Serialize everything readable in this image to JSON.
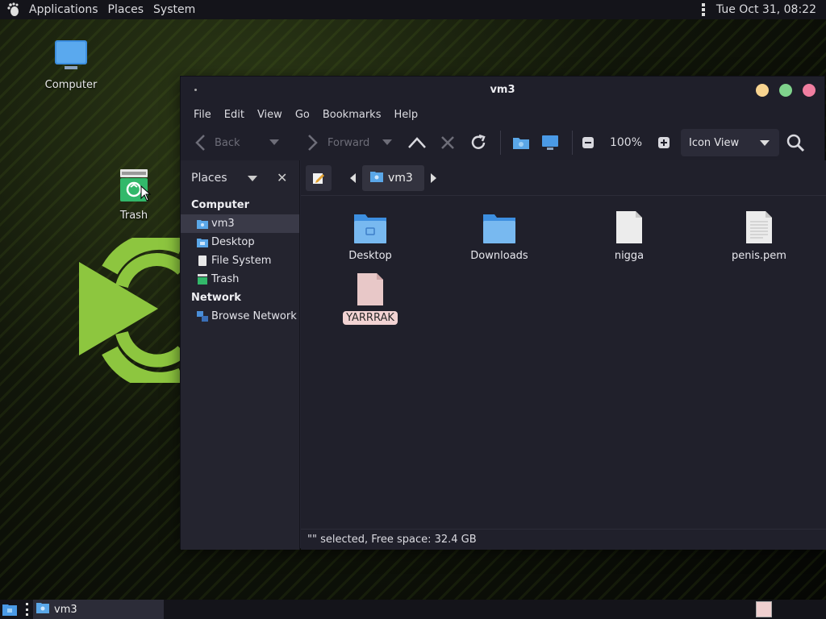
{
  "top_panel": {
    "menus": [
      "Applications",
      "Places",
      "System"
    ],
    "clock": "Tue Oct 31, 08:22"
  },
  "desktop": {
    "icons": [
      {
        "label": "Computer",
        "icon": "monitor-icon"
      },
      {
        "label": "Trash",
        "icon": "trash-icon"
      }
    ]
  },
  "window": {
    "title": "vm3",
    "menubar": [
      "File",
      "Edit",
      "View",
      "Go",
      "Bookmarks",
      "Help"
    ],
    "toolbar": {
      "back_label": "Back",
      "forward_label": "Forward",
      "zoom": "100%",
      "view_mode": "Icon View"
    },
    "sidebar": {
      "header": "Places",
      "sections": [
        {
          "title": "Computer",
          "items": [
            "vm3",
            "Desktop",
            "File System",
            "Trash"
          ]
        },
        {
          "title": "Network",
          "items": [
            "Browse Network"
          ]
        }
      ],
      "selected": "vm3"
    },
    "pathbar": {
      "crumb": "vm3"
    },
    "files": [
      {
        "name": "Desktop",
        "type": "folder"
      },
      {
        "name": "Downloads",
        "type": "folder"
      },
      {
        "name": "nigga",
        "type": "file"
      },
      {
        "name": "penis.pem",
        "type": "text-file"
      },
      {
        "name": "YARRRAK",
        "type": "file-selected"
      }
    ],
    "status": "\"\" selected, Free space: 32.4 GB"
  },
  "bottom_panel": {
    "task_label": "vm3"
  },
  "colors": {
    "accent_folder": "#5aa7e8",
    "selection_label": "#f2d3d3",
    "mint_green": "#8dc63f"
  }
}
